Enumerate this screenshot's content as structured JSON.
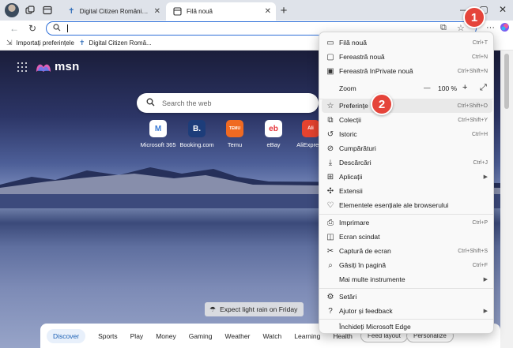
{
  "tabs": [
    {
      "label": "Digital Citizen România - Viața în l",
      "favicon": "dc-icon",
      "active": false
    },
    {
      "label": "Filă nouă",
      "favicon": "newtab-icon",
      "active": true
    }
  ],
  "address": {
    "value": "",
    "placeholder": ""
  },
  "favorites": [
    {
      "label": "Importați preferințele",
      "icon": "import-icon"
    },
    {
      "label": "Digital Citizen Româ...",
      "icon": "dc-icon"
    }
  ],
  "msn": {
    "brand": "msn"
  },
  "search": {
    "placeholder": "Search the web"
  },
  "quick_links": [
    {
      "label": "Microsoft 365",
      "tile": "M",
      "color": "#3a7bd5"
    },
    {
      "label": "Booking.com",
      "tile": "B.",
      "color": "#1d3d7a"
    },
    {
      "label": "Temu",
      "tile": "TEMU",
      "color": "#f06a22"
    },
    {
      "label": "eBay",
      "tile": "eb",
      "color": "#e53238"
    },
    {
      "label": "AliExpress",
      "tile": "Ali",
      "color": "#e5432f"
    }
  ],
  "weather": {
    "text": "Expect light rain on Friday"
  },
  "feed": {
    "items": [
      "Discover",
      "Sports",
      "Play",
      "Money",
      "Gaming",
      "Weather",
      "Watch",
      "Learning",
      "Health"
    ],
    "active": "Discover",
    "feed_layout": "Feed layout",
    "personalize": "Personalize"
  },
  "menu": {
    "items": [
      {
        "label": "Filă nouă",
        "shortcut": "Ctrl+T",
        "icon": "new-tab-icon"
      },
      {
        "label": "Fereastră nouă",
        "shortcut": "Ctrl+N",
        "icon": "new-window-icon"
      },
      {
        "label": "Fereastră InPrivate nouă",
        "shortcut": "Ctrl+Shift+N",
        "icon": "inprivate-icon"
      },
      {
        "label": "Zoom",
        "shortcut": "",
        "icon": ""
      },
      {
        "label": "Preferințe",
        "shortcut": "Ctrl+Shift+O",
        "icon": "favorites-star-icon"
      },
      {
        "label": "Colecții",
        "shortcut": "Ctrl+Shift+Y",
        "icon": "collections-icon"
      },
      {
        "label": "Istoric",
        "shortcut": "Ctrl+H",
        "icon": "history-icon"
      },
      {
        "label": "Cumpărături",
        "shortcut": "",
        "icon": "shopping-icon"
      },
      {
        "label": "Descărcări",
        "shortcut": "Ctrl+J",
        "icon": "download-icon"
      },
      {
        "label": "Aplicații",
        "shortcut": "",
        "icon": "apps-icon",
        "submenu": true
      },
      {
        "label": "Extensii",
        "shortcut": "",
        "icon": "extensions-icon"
      },
      {
        "label": "Elementele esențiale ale browserului",
        "shortcut": "",
        "icon": "heart-pulse-icon"
      },
      {
        "label": "Imprimare",
        "shortcut": "Ctrl+P",
        "icon": "print-icon"
      },
      {
        "label": "Ecran scindat",
        "shortcut": "",
        "icon": "split-screen-icon"
      },
      {
        "label": "Captură de ecran",
        "shortcut": "Ctrl+Shift+S",
        "icon": "screenshot-icon"
      },
      {
        "label": "Găsiți în pagină",
        "shortcut": "Ctrl+F",
        "icon": "find-icon"
      },
      {
        "label": "Mai multe instrumente",
        "shortcut": "",
        "icon": "",
        "submenu": true
      },
      {
        "label": "Setări",
        "shortcut": "",
        "icon": "settings-gear-icon"
      },
      {
        "label": "Ajutor și feedback",
        "shortcut": "",
        "icon": "help-icon",
        "submenu": true
      },
      {
        "label": "Închideți Microsoft Edge",
        "shortcut": "",
        "icon": ""
      }
    ],
    "zoom_level": "100 %",
    "zoom_minus": "—",
    "zoom_plus": "+"
  },
  "steps": [
    "1",
    "2"
  ]
}
